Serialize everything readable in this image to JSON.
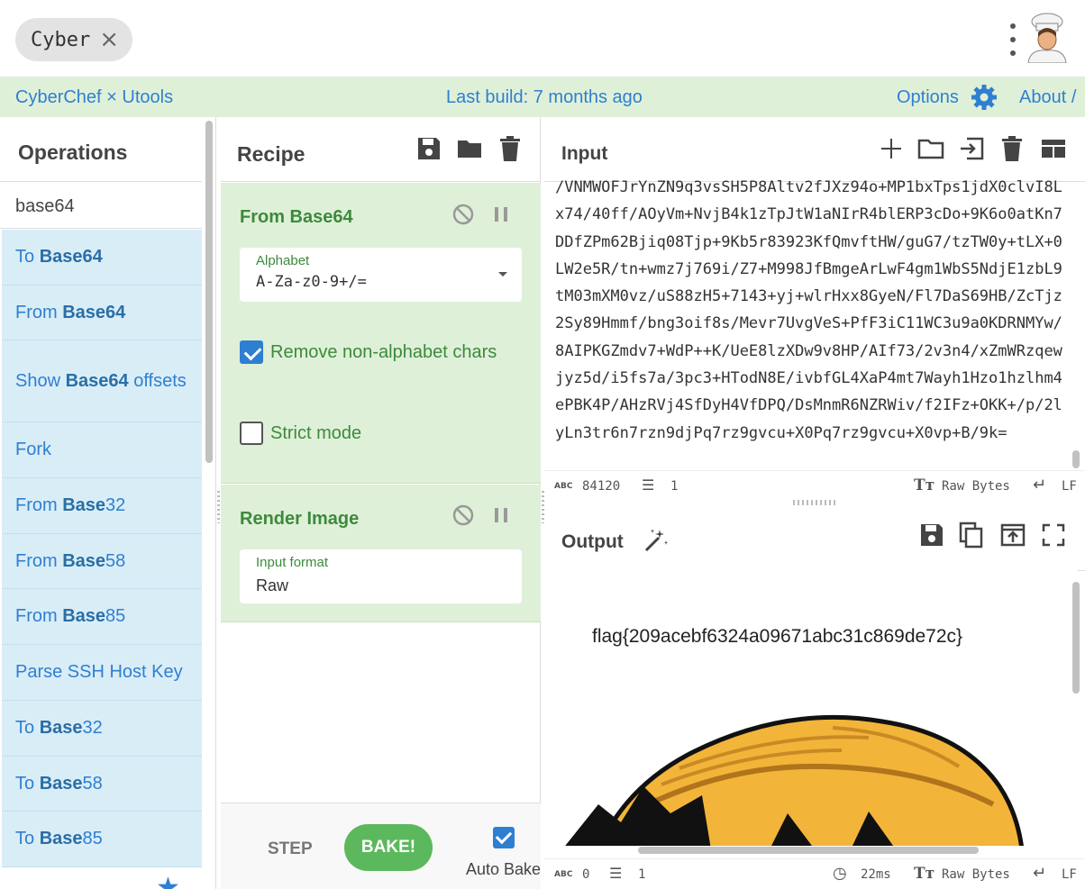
{
  "tabs": {
    "active_label": "Cyber"
  },
  "banner": {
    "brand": "CyberChef × Utools",
    "build": "Last build: 7 months ago",
    "options": "Options",
    "about": "About /"
  },
  "operations": {
    "title": "Operations",
    "search_value": "base64",
    "items": [
      {
        "pre": "To ",
        "bold": "Base64",
        "post": ""
      },
      {
        "pre": "From ",
        "bold": "Base64",
        "post": ""
      },
      {
        "pre": "Show ",
        "bold": "Base64",
        "post": " offsets"
      },
      {
        "pre": "Fork",
        "bold": "",
        "post": ""
      },
      {
        "pre": "From ",
        "bold": "Base",
        "post": "32"
      },
      {
        "pre": "From ",
        "bold": "Base",
        "post": "58"
      },
      {
        "pre": "From ",
        "bold": "Base",
        "post": "85"
      },
      {
        "pre": "Parse SSH Host Key",
        "bold": "",
        "post": ""
      },
      {
        "pre": "To ",
        "bold": "Base",
        "post": "32"
      },
      {
        "pre": "To ",
        "bold": "Base",
        "post": "58"
      },
      {
        "pre": "To ",
        "bold": "Base",
        "post": "85"
      }
    ]
  },
  "recipe": {
    "title": "Recipe",
    "from_base64": {
      "name": "From Base64",
      "alphabet_label": "Alphabet",
      "alphabet_value": "A-Za-z0-9+/=",
      "remove_nonalpha_label": "Remove non-alphabet chars",
      "remove_nonalpha_checked": true,
      "strict_label": "Strict mode",
      "strict_checked": false
    },
    "render_image": {
      "name": "Render Image",
      "format_label": "Input format",
      "format_value": "Raw"
    },
    "step_label": "STEP",
    "bake_label": "BAKE!",
    "auto_bake_label": "Auto Bake",
    "auto_bake_checked": true
  },
  "input": {
    "title": "Input",
    "text": "/VNMWOFJrYnZN9q3vsSH5P8Altv2fJXz94o+MP1bxTps1jdX0clvI8Lx74/40ff/AOyVm+NvjB4k1zTpJtW1aNIrR4blERP3cDo+9K6o0atKn7DDfZPm62Bjiq08Tjp+9Kb5r83923KfQmvftHW/guG7/tzTW0y+tLX+0LW2e5R/tn+wmz7j769i/Z7+M998JfBmgeArLwF4gm1WbS5NdjE1zbL9tM03mXM0vz/uS88zH5+7143+yj+wlrHxx8GyeN/Fl7DaS69HB/ZcTjz2Sy89Hmmf/bng3oif8s/Mevr7UvgVeS+PfF3iC11WC3u9a0KDRNMYw/8AIPKGZmdv7+WdP++K/UeE8lzXDw9v8HP/AIf73/2v3n4/xZmWRzqewjyz5d/i5fs7a/3pc3+HTodN8E/ivbfGL4XaP4mt7Wayh1Hzo1hzlhm4ePBK4P/AHzRVj4SfDyH4VfDPQ/DsMnmR6NZRWiv/f2IFz+OKK+/p/2lyLn3tr6n7rzn9djPq7rz9gvcu+X0Pq7rz9gvcu+X0vp+B/9k="
  },
  "input_status": {
    "length": "84120",
    "lines": "1",
    "encoding": "Raw Bytes",
    "eol": "LF"
  },
  "output": {
    "title": "Output",
    "flag_text": "flag{209acebf6324a09671abc31c869de72c}"
  },
  "output_status": {
    "length": "0",
    "lines": "1",
    "time": "22ms",
    "encoding": "Raw Bytes",
    "eol": "LF"
  },
  "colors": {
    "banner_bg": "#dff0d8",
    "link": "#2f7fd1",
    "op_item_bg": "#d9edf7",
    "recipe_green": "#3c8a3c",
    "bake_green": "#5cb85c"
  }
}
